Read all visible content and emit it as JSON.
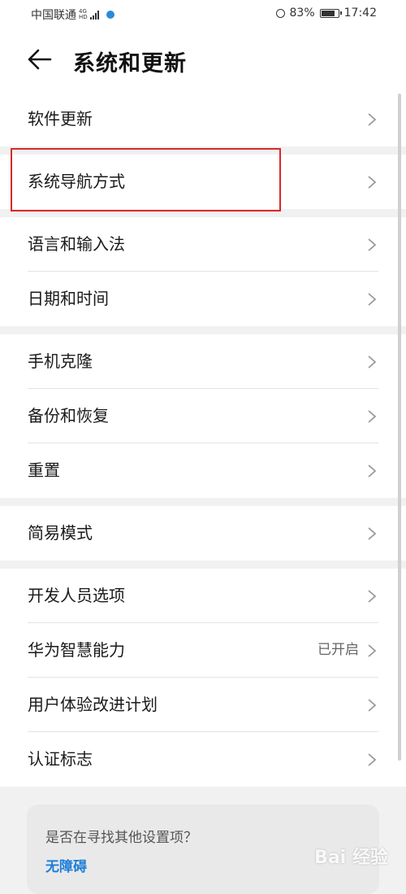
{
  "status_bar": {
    "carrier": "中国联通",
    "network_top": "4G",
    "network_bottom": "HD",
    "battery": "83%",
    "time": "17:42"
  },
  "header": {
    "title": "系统和更新",
    "back_icon": "arrow-left-icon"
  },
  "groups": [
    {
      "items": [
        {
          "label": "软件更新"
        }
      ]
    },
    {
      "items": [
        {
          "label": "系统导航方式",
          "highlighted": true
        }
      ]
    },
    {
      "items": [
        {
          "label": "语言和输入法"
        },
        {
          "label": "日期和时间"
        }
      ]
    },
    {
      "items": [
        {
          "label": "手机克隆"
        },
        {
          "label": "备份和恢复"
        },
        {
          "label": "重置"
        }
      ]
    },
    {
      "items": [
        {
          "label": "简易模式"
        }
      ]
    },
    {
      "items": [
        {
          "label": "开发人员选项"
        },
        {
          "label": "华为智慧能力",
          "value": "已开启"
        },
        {
          "label": "用户体验改进计划"
        },
        {
          "label": "认证标志"
        }
      ]
    }
  ],
  "suggestion": {
    "question": "是否在寻找其他设置项？",
    "link": "无障碍"
  },
  "watermark": "Bai 经验",
  "colors": {
    "accent": "#1f7fd8",
    "highlight_border": "#d9282a",
    "background": "#f1f1f1"
  }
}
